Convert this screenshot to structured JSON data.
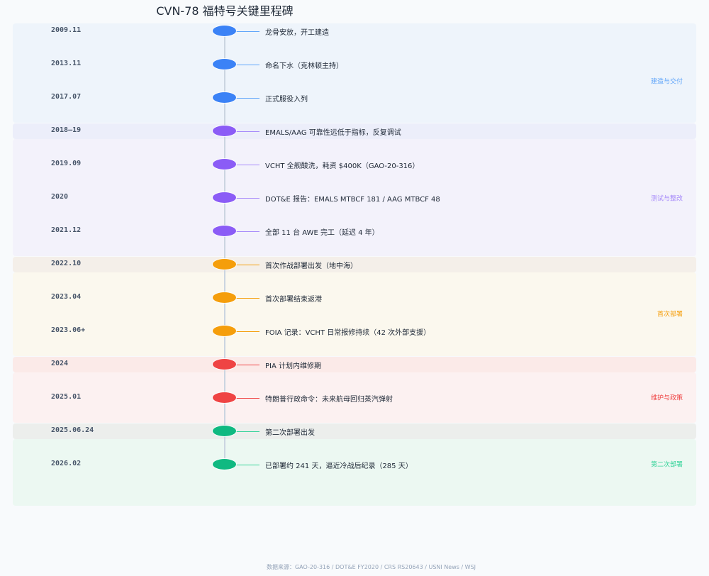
{
  "title": "CVN-78 福特号关键里程碑",
  "phases": [
    {
      "label": "建造与交付",
      "color": "#60a5fa"
    },
    {
      "label": "测试与整改",
      "color": "#a78bfa"
    },
    {
      "label": "首次部署",
      "color": "#f59e0b"
    },
    {
      "label": "维护与政策",
      "color": "#ef4444"
    },
    {
      "label": "第二次部署",
      "color": "#34d399"
    }
  ],
  "events": [
    {
      "date": "2009.11",
      "text": "龙骨安放，开工建造",
      "phase": 0
    },
    {
      "date": "2013.11",
      "text": "命名下水（克林顿主持）",
      "phase": 0
    },
    {
      "date": "2017.07",
      "text": "正式服役入列",
      "phase": 0
    },
    {
      "date": "2018–19",
      "text": "EMALS/AAG 可靠性远低于指标，反复调试",
      "phase": 1
    },
    {
      "date": "2019.09",
      "text": "VCHT 全舰酸洗，耗资 $400K（GAO-20-316）",
      "phase": 1
    },
    {
      "date": "2020",
      "text": "DOT&E 报告：EMALS MTBCF 181 / AAG MTBCF 48",
      "phase": 1
    },
    {
      "date": "2021.12",
      "text": "全部 11 台 AWE 完工（延迟 4 年）",
      "phase": 1
    },
    {
      "date": "2022.10",
      "text": "首次作战部署出发（地中海）",
      "phase": 2
    },
    {
      "date": "2023.04",
      "text": "首次部署结束返港",
      "phase": 2
    },
    {
      "date": "2023.06+",
      "text": "FOIA 记录：VCHT 日常报修持续（42 次外部支援）",
      "phase": 2
    },
    {
      "date": "2024",
      "text": "PIA 计划内维修期",
      "phase": 3
    },
    {
      "date": "2025.01",
      "text": "特朗普行政命令：未来航母回归蒸汽弹射",
      "phase": 3
    },
    {
      "date": "2025.06.24",
      "text": "第二次部署出发",
      "phase": 4
    },
    {
      "date": "2026.02",
      "text": "已部署约 241 天，逼近冷战后纪录（285 天）",
      "phase": 4
    }
  ],
  "footer": "数据来源：GAO-20-316 / DOT&E FY2020 / CRS RS20643 / USNI News / WSJ"
}
